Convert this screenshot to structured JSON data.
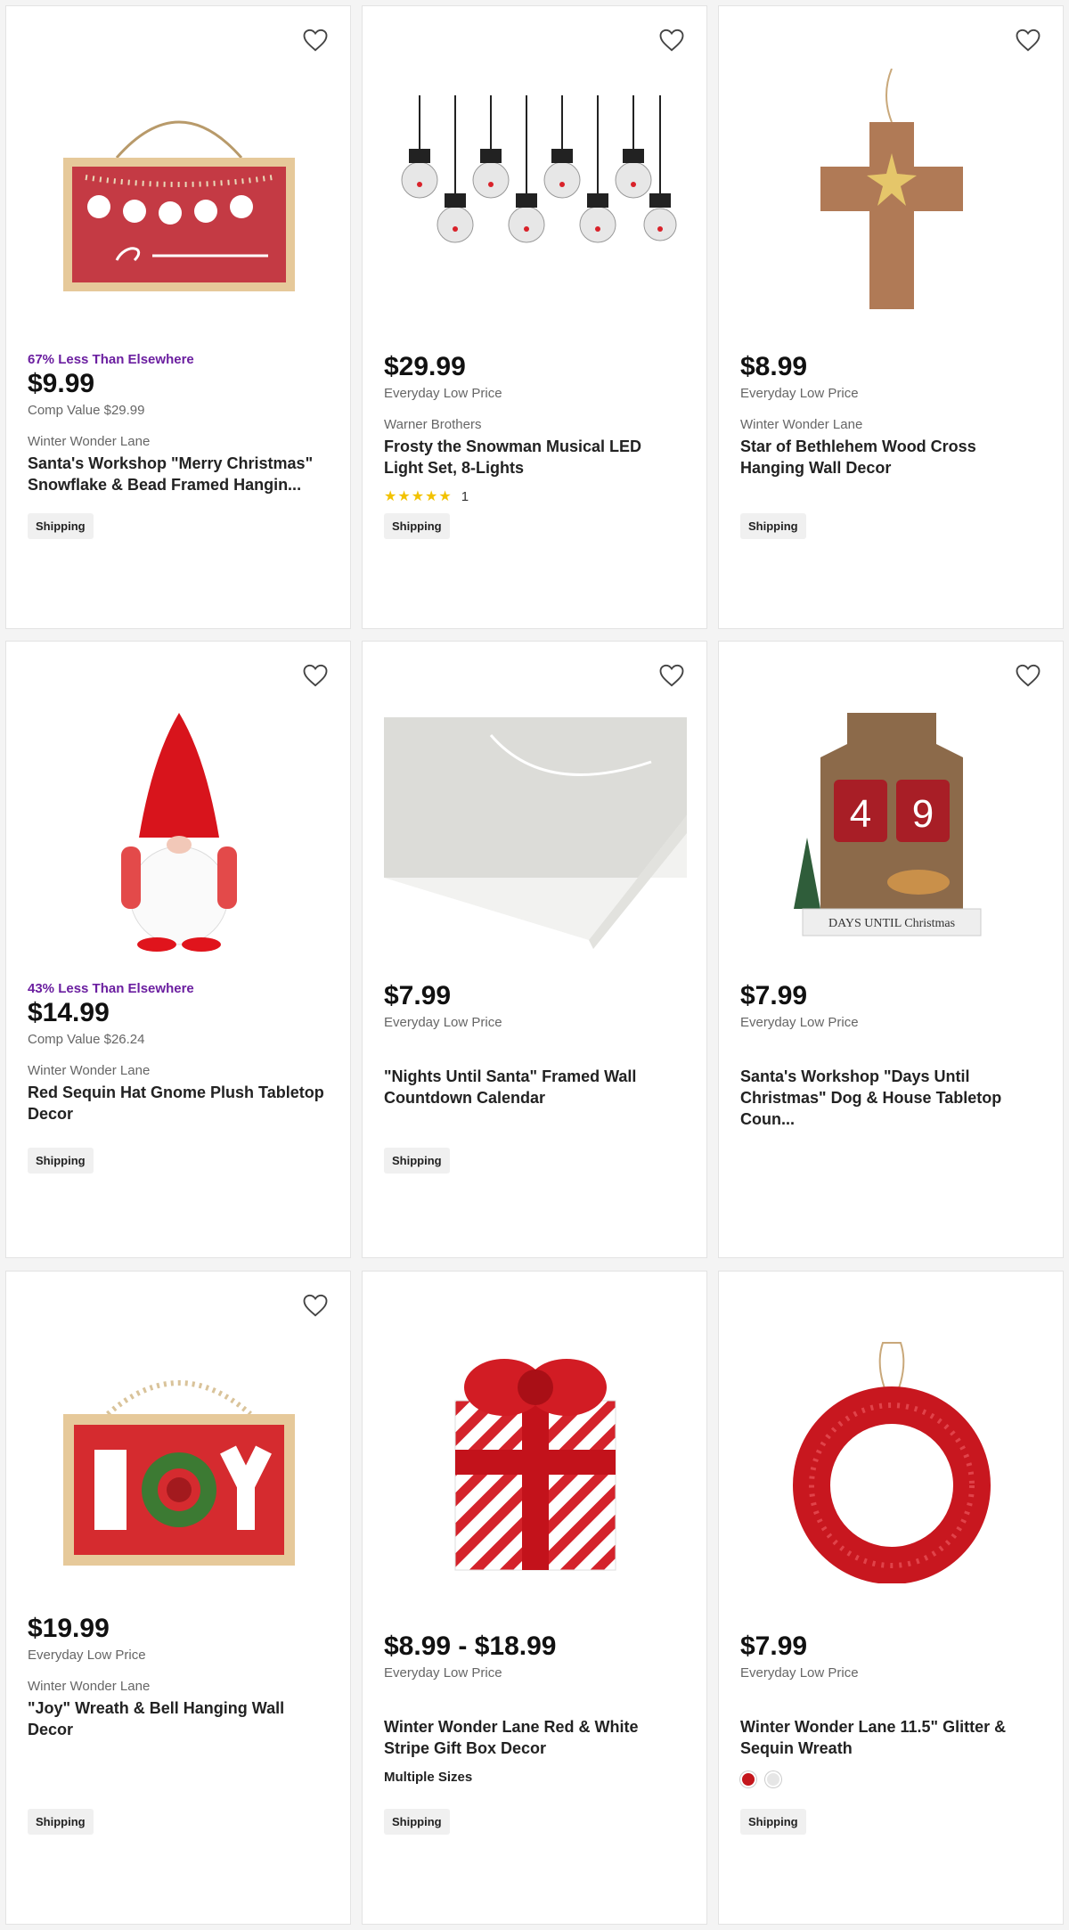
{
  "products": [
    {
      "promo": "67% Less Than Elsewhere",
      "price": "$9.99",
      "price_note": "Comp Value $29.99",
      "brand": "Winter Wonder Lane",
      "title": "Santa's Workshop \"Merry Christmas\" Snowflake & Bead Framed Hangin...",
      "shipping": "Shipping",
      "image_icon": "christmas-sign"
    },
    {
      "price": "$29.99",
      "price_note": "Everyday Low Price",
      "brand": "Warner Brothers",
      "title": "Frosty the Snowman Musical LED Light Set, 8-Lights",
      "rating": 5,
      "rating_count": "1",
      "shipping": "Shipping",
      "image_icon": "snowman-lights"
    },
    {
      "price": "$8.99",
      "price_note": "Everyday Low Price",
      "brand": "Winter Wonder Lane",
      "title": "Star of Bethlehem Wood Cross Hanging Wall Decor",
      "shipping": "Shipping",
      "image_icon": "wood-cross"
    },
    {
      "promo": "43% Less Than Elsewhere",
      "price": "$14.99",
      "price_note": "Comp Value $26.24",
      "brand": "Winter Wonder Lane",
      "title": "Red Sequin Hat Gnome Plush Tabletop Decor",
      "shipping": "Shipping",
      "image_icon": "gnome"
    },
    {
      "price": "$7.99",
      "price_note": "Everyday Low Price",
      "title": "\"Nights Until Santa\" Framed Wall Countdown Calendar",
      "shipping": "Shipping",
      "image_icon": "countdown-calendar"
    },
    {
      "price": "$7.99",
      "price_note": "Everyday Low Price",
      "title": "Santa's Workshop \"Days Until Christmas\" Dog & House Tabletop Coun...",
      "shipping": "",
      "image_icon": "house-countdown",
      "image_text": {
        "digits": "49",
        "caption": "DAYS UNTIL Christmas"
      }
    },
    {
      "price": "$19.99",
      "price_note": "Everyday Low Price",
      "brand": "Winter Wonder Lane",
      "title": "\"Joy\" Wreath & Bell Hanging Wall Decor",
      "shipping": "Shipping",
      "image_icon": "joy-sign"
    },
    {
      "price": "$8.99 - $18.99",
      "price_note": "Everyday Low Price",
      "title": "Winter Wonder Lane Red & White Stripe Gift Box Decor",
      "sizes": "Multiple Sizes",
      "shipping": "Shipping",
      "image_icon": "gift-box"
    },
    {
      "price": "$7.99",
      "price_note": "Everyday Low Price",
      "title": "Winter Wonder Lane 11.5\" Glitter & Sequin Wreath",
      "swatches": [
        "#c4161c",
        "#e6e6e6"
      ],
      "shipping": "Shipping",
      "image_icon": "glitter-wreath"
    }
  ],
  "colors": {
    "promo": "#6b1fa0",
    "star": "#f2c200",
    "accent_red": "#c4161c"
  }
}
